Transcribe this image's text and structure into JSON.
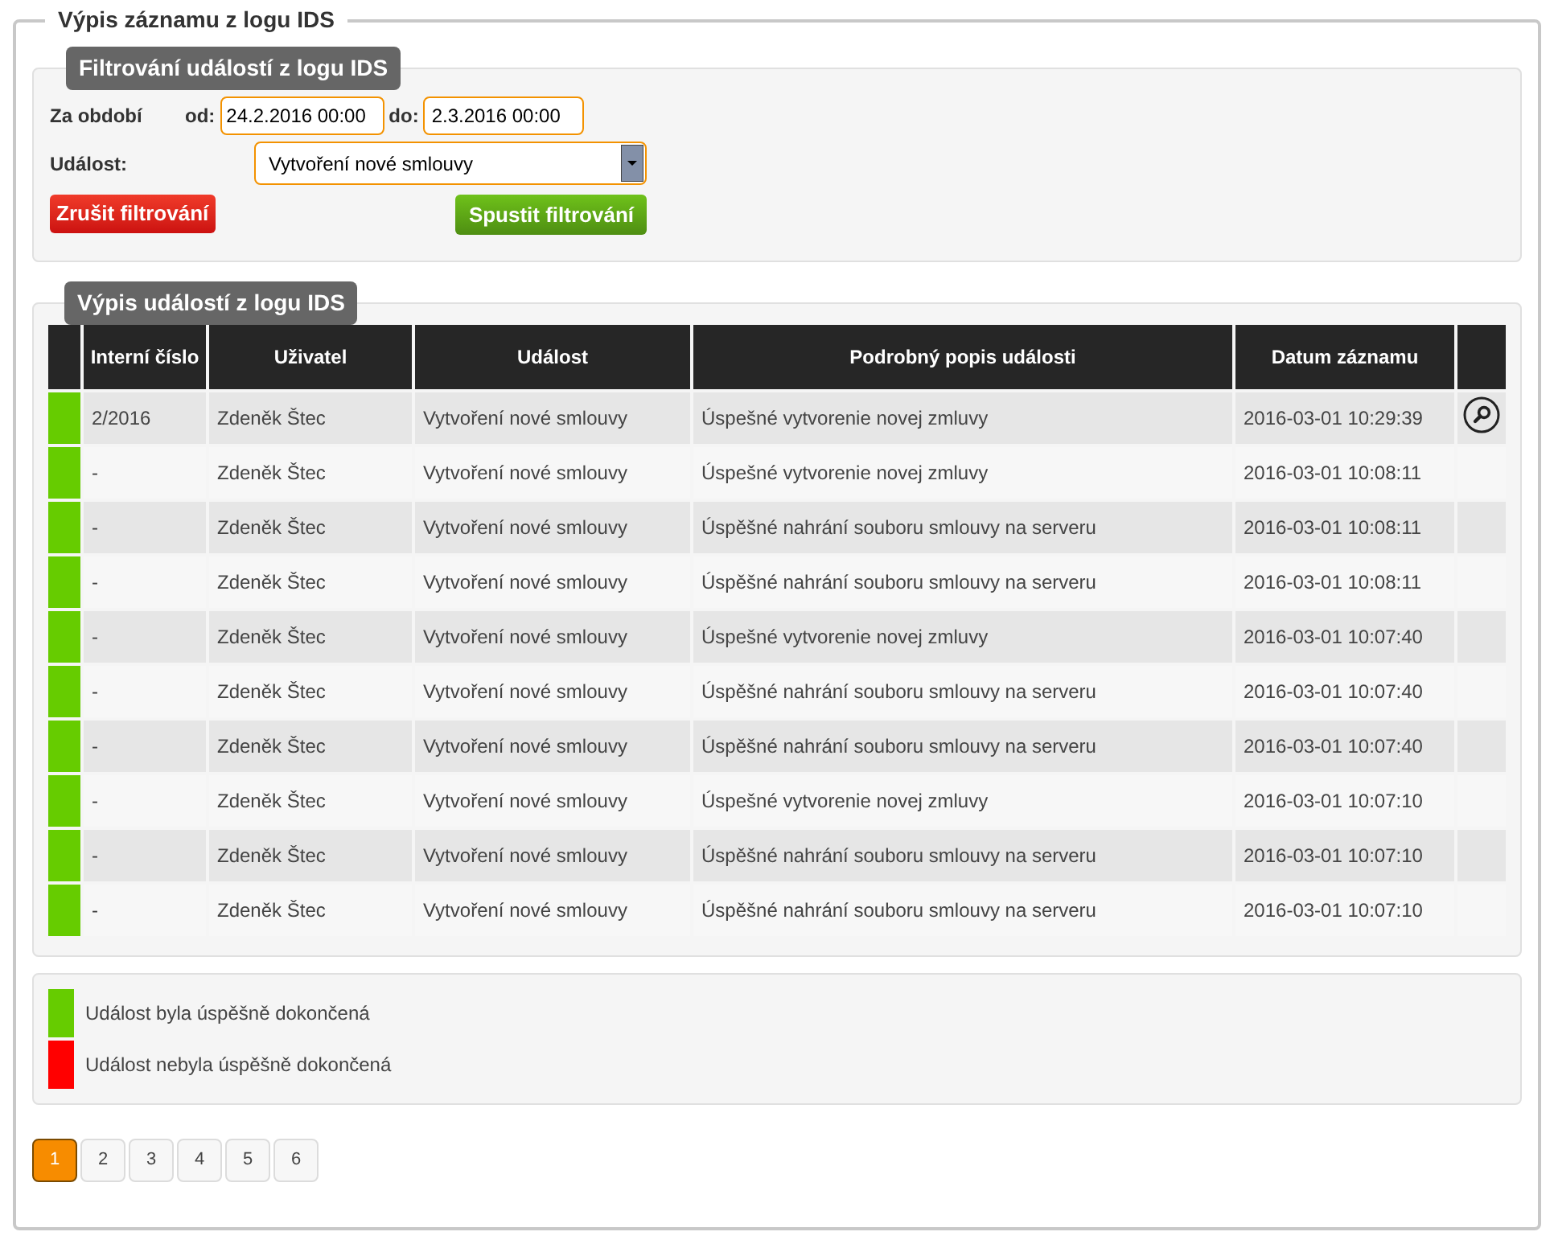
{
  "title": "Výpis záznamu z logu IDS",
  "filter": {
    "title": "Filtrování událostí z logu IDS",
    "period_label": "Za období",
    "from_label": "od:",
    "from_value": "24.2.2016 00:00",
    "to_label": "do:",
    "to_value": "2.3.2016 00:00",
    "event_label": "Událost:",
    "event_value": "Vytvoření nové smlouvy",
    "cancel_button": "Zrušit filtrování",
    "run_button": "Spustit filtrování"
  },
  "events": {
    "title": "Výpis událostí z logu IDS",
    "columns": [
      "Interní číslo",
      "Uživatel",
      "Událost",
      "Podrobný popis události",
      "Datum záznamu"
    ],
    "rows": [
      {
        "color": "#66cc00",
        "number": "2/2016",
        "user": "Zdeněk Štec",
        "event": "Vytvoření nové smlouvy",
        "description": "Úspešné vytvorenie novej zmluvy",
        "date": "2016-03-01 10:29:39",
        "detail": true
      },
      {
        "color": "#66cc00",
        "number": "-",
        "user": "Zdeněk Štec",
        "event": "Vytvoření nové smlouvy",
        "description": "Úspešné vytvorenie novej zmluvy",
        "date": "2016-03-01 10:08:11",
        "detail": false
      },
      {
        "color": "#66cc00",
        "number": "-",
        "user": "Zdeněk Štec",
        "event": "Vytvoření nové smlouvy",
        "description": "Úspěšné nahrání souboru smlouvy na serveru",
        "date": "2016-03-01 10:08:11",
        "detail": false
      },
      {
        "color": "#66cc00",
        "number": "-",
        "user": "Zdeněk Štec",
        "event": "Vytvoření nové smlouvy",
        "description": "Úspěšné nahrání souboru smlouvy na serveru",
        "date": "2016-03-01 10:08:11",
        "detail": false
      },
      {
        "color": "#66cc00",
        "number": "-",
        "user": "Zdeněk Štec",
        "event": "Vytvoření nové smlouvy",
        "description": "Úspešné vytvorenie novej zmluvy",
        "date": "2016-03-01 10:07:40",
        "detail": false
      },
      {
        "color": "#66cc00",
        "number": "-",
        "user": "Zdeněk Štec",
        "event": "Vytvoření nové smlouvy",
        "description": "Úspěšné nahrání souboru smlouvy na serveru",
        "date": "2016-03-01 10:07:40",
        "detail": false
      },
      {
        "color": "#66cc00",
        "number": "-",
        "user": "Zdeněk Štec",
        "event": "Vytvoření nové smlouvy",
        "description": "Úspěšné nahrání souboru smlouvy na serveru",
        "date": "2016-03-01 10:07:40",
        "detail": false
      },
      {
        "color": "#66cc00",
        "number": "-",
        "user": "Zdeněk Štec",
        "event": "Vytvoření nové smlouvy",
        "description": "Úspešné vytvorenie novej zmluvy",
        "date": "2016-03-01 10:07:10",
        "detail": false
      },
      {
        "color": "#66cc00",
        "number": "-",
        "user": "Zdeněk Štec",
        "event": "Vytvoření nové smlouvy",
        "description": "Úspěšné nahrání souboru smlouvy na serveru",
        "date": "2016-03-01 10:07:10",
        "detail": false
      },
      {
        "color": "#66cc00",
        "number": "-",
        "user": "Zdeněk Štec",
        "event": "Vytvoření nové smlouvy",
        "description": "Úspěšné nahrání souboru smlouvy na serveru",
        "date": "2016-03-01 10:07:10",
        "detail": false
      }
    ]
  },
  "legend": [
    {
      "color": "#66cc00",
      "label": "Událost byla úspěšně dokončená"
    },
    {
      "color": "#ff0000",
      "label": "Událost nebyla úspěšně dokončená"
    }
  ],
  "pagination": [
    {
      "label": "1",
      "selected": true
    },
    {
      "label": "2",
      "selected": false
    },
    {
      "label": "3",
      "selected": false
    },
    {
      "label": "4",
      "selected": false
    },
    {
      "label": "5",
      "selected": false
    },
    {
      "label": "6",
      "selected": false
    }
  ]
}
